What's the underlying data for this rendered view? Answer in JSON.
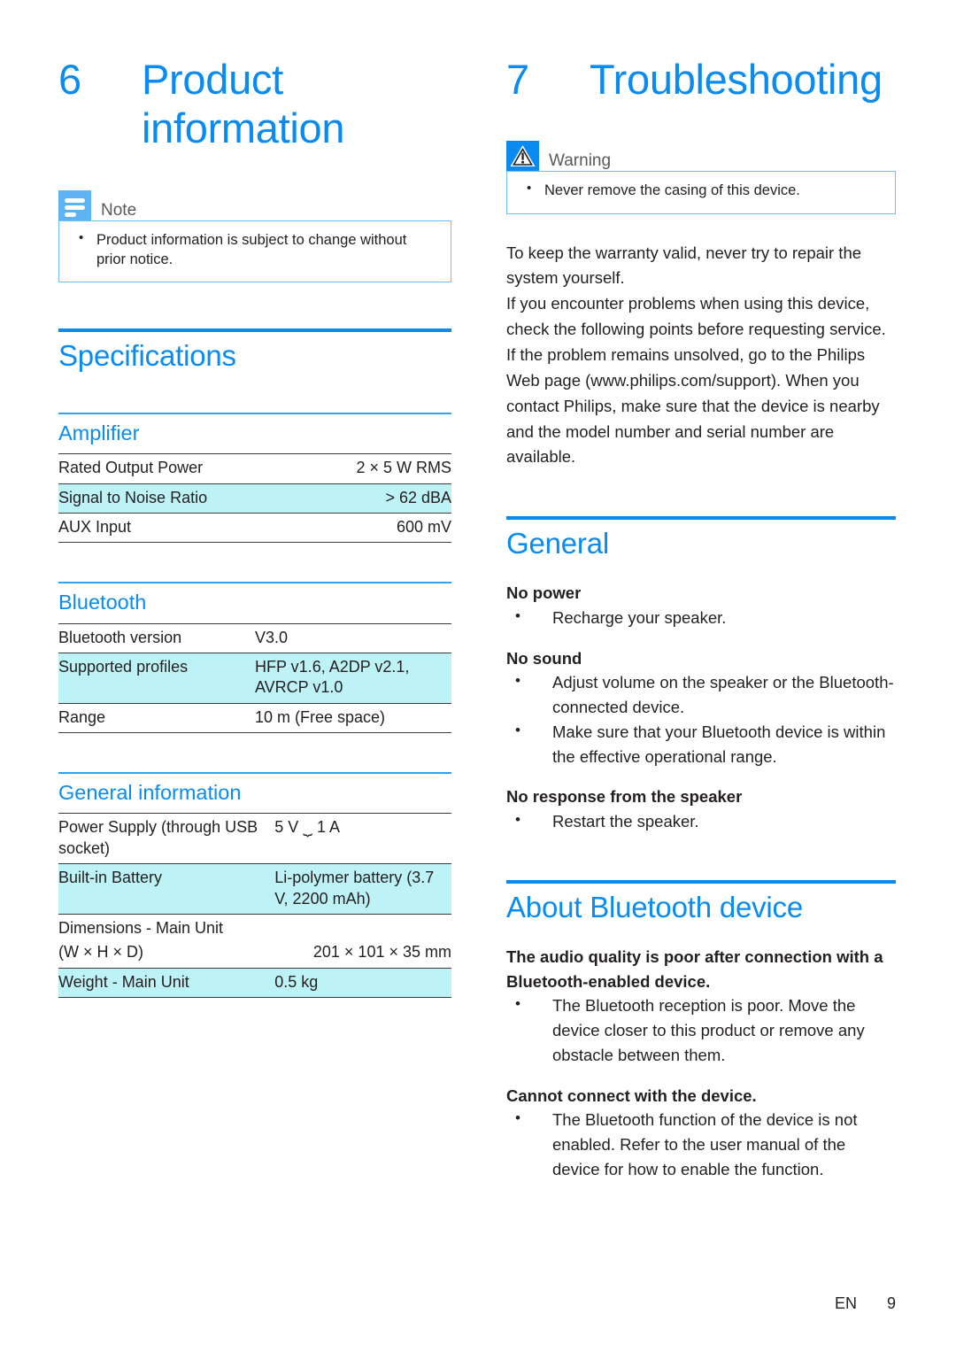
{
  "colors": {
    "brand_blue": "#0A8BF0",
    "note_icon_blue": "#5DB3F3",
    "row_highlight": "#BDF3F7",
    "body_text": "#231F20"
  },
  "left_column": {
    "chapter": {
      "number": "6",
      "title": "Product information"
    },
    "note": {
      "label": "Note",
      "icon": "note-lines-icon",
      "items": [
        "Product information is subject to change without prior notice."
      ]
    },
    "specifications": {
      "heading": "Specifications",
      "amplifier": {
        "heading": "Amplifier",
        "rows": [
          {
            "label": "Rated Output Power",
            "value": "2 × 5 W RMS",
            "highlight": false
          },
          {
            "label": "Signal to Noise Ratio",
            "value": "> 62 dBA",
            "highlight": true
          },
          {
            "label": "AUX Input",
            "value": "600 mV",
            "highlight": false
          }
        ]
      },
      "bluetooth": {
        "heading": "Bluetooth",
        "rows": [
          {
            "label": "Bluetooth version",
            "value": "V3.0",
            "highlight": false
          },
          {
            "label": "Supported profiles",
            "value": "HFP v1.6, A2DP v2.1, AVRCP v1.0",
            "highlight": true
          },
          {
            "label": "Range",
            "value": "10 m (Free space)",
            "highlight": false
          }
        ]
      },
      "general_information": {
        "heading": "General information",
        "rows": [
          {
            "label": "Power Supply (through USB socket)",
            "value": "5 V ⏟ 1 A",
            "highlight": false
          },
          {
            "label": "Built-in Battery",
            "value": "Li-polymer battery (3.7 V, 2200 mAh)",
            "highlight": true
          },
          {
            "label_line1": "Dimensions - Main Unit",
            "label_line2": "(W × H × D)",
            "value": "201 × 101 × 35 mm",
            "highlight": false
          },
          {
            "label": "Weight - Main Unit",
            "value": "0.5 kg",
            "highlight": true
          }
        ]
      }
    }
  },
  "right_column": {
    "chapter": {
      "number": "7",
      "title": "Troubleshooting"
    },
    "warning": {
      "label": "Warning",
      "icon": "warning-triangle-icon",
      "items": [
        "Never remove the casing of this device."
      ]
    },
    "intro_paragraphs": [
      "To keep the warranty valid, never try to repair the system yourself.",
      "If you encounter problems when using this device, check the following points before requesting service. If the problem remains unsolved, go to the Philips Web page (www.philips.com/support). When you contact Philips, make sure that the device is nearby and the model number and serial number are available."
    ],
    "general": {
      "heading": "General",
      "groups": [
        {
          "title": "No power",
          "items": [
            "Recharge your speaker."
          ]
        },
        {
          "title": "No sound",
          "items": [
            "Adjust volume on the speaker or the Bluetooth-connected device.",
            "Make sure that your Bluetooth device is within the effective operational range."
          ]
        },
        {
          "title": "No response from the speaker",
          "items": [
            "Restart the speaker."
          ]
        }
      ]
    },
    "about_bluetooth": {
      "heading": "About Bluetooth device",
      "groups": [
        {
          "title": "The audio quality is poor after connection with a Bluetooth-enabled device.",
          "items": [
            "The Bluetooth reception is poor. Move the device closer to this product or remove any obstacle between them."
          ]
        },
        {
          "title": "Cannot connect with the device.",
          "items": [
            "The Bluetooth function of the device is not enabled. Refer to the user manual of the device for how to enable the function."
          ]
        }
      ]
    }
  },
  "footer": {
    "language": "EN",
    "page_number": "9"
  }
}
